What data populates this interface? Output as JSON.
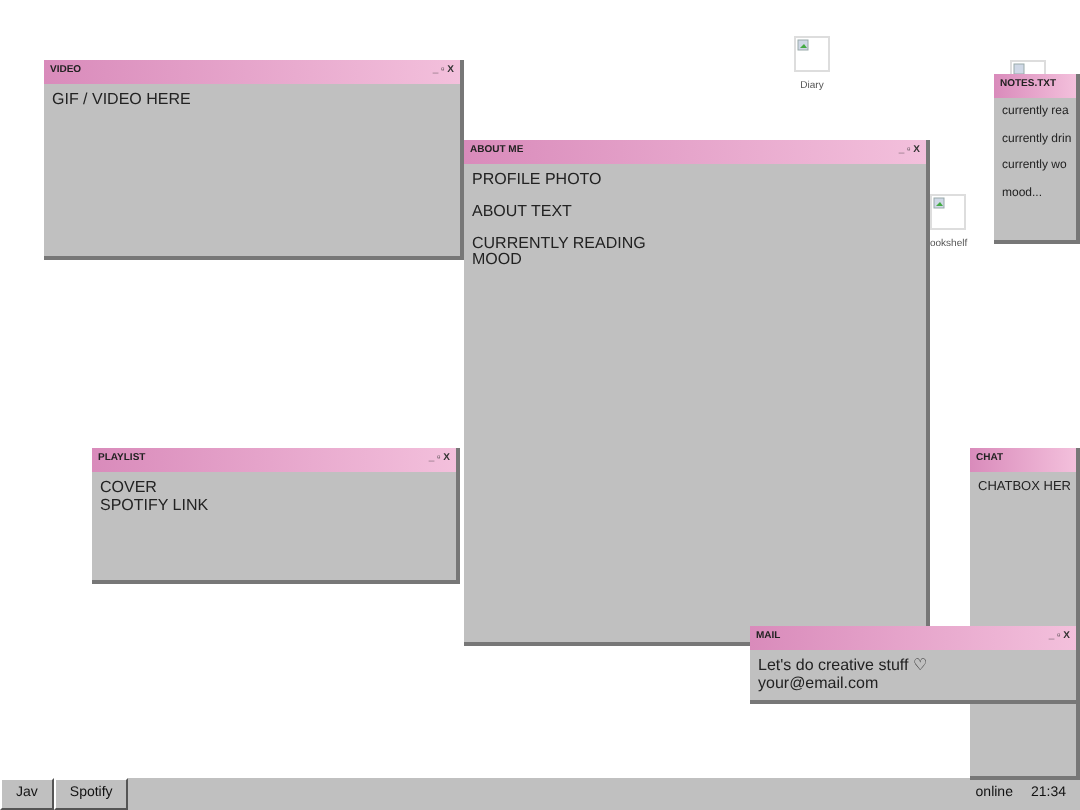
{
  "desktop_icons": [
    {
      "label": "Diary"
    },
    {
      "label": "ookshelf"
    }
  ],
  "windows": [
    {
      "title": "VIDEO",
      "controls": "_ ▫ X",
      "paragraphs": [
        [
          "GIF / VIDEO HERE"
        ]
      ]
    },
    {
      "title": "ABOUT ME",
      "controls": "_ ▫ X",
      "paragraphs": [
        [
          "PROFILE PHOTO"
        ],
        [
          "ABOUT TEXT"
        ],
        [
          "CURRENTLY READING",
          "MOOD"
        ]
      ]
    },
    {
      "title": "NOTES.TXT",
      "paragraphs": [
        [
          "currently rea"
        ],
        [
          "currently drin"
        ],
        [
          "currently wo"
        ],
        [
          "mood..."
        ]
      ]
    },
    {
      "title": "PLAYLIST",
      "controls": "_ ▫ X",
      "paragraphs": [
        [
          "COVER",
          "SPOTIFY LINK"
        ]
      ]
    },
    {
      "title": "CHAT",
      "paragraphs": [
        [
          "CHATBOX HER"
        ]
      ]
    },
    {
      "title": "MAIL",
      "controls": "_ ▫ X",
      "paragraphs": [
        [
          "Let's do creative stuff ♡",
          "your@email.com"
        ]
      ]
    }
  ],
  "taskbar": {
    "buttons": [
      "Jav",
      "Spotify"
    ],
    "status": "online",
    "clock": "21:34"
  }
}
